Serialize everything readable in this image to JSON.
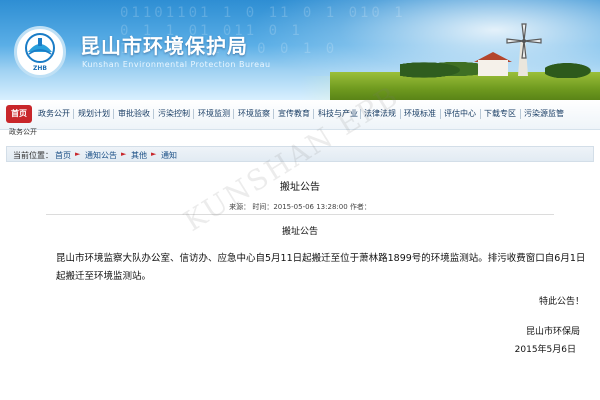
{
  "header": {
    "title": "昆山市环境保护局",
    "subtitle": "Kunshan Environmental Protection Bureau",
    "logo_label": "ZHB",
    "binary_pattern": "01101101 1 0 11 0 1 010 1\n0 1 1 01 011 0 1\n1 0 1 0 1 1 0 0 1 0"
  },
  "nav": {
    "items": [
      {
        "label": "首页",
        "active": true
      },
      {
        "label": "政务公开"
      },
      {
        "label": "规划计划"
      },
      {
        "label": "审批验收"
      },
      {
        "label": "污染控制"
      },
      {
        "label": "环境监测"
      },
      {
        "label": "环境监察"
      },
      {
        "label": "宣传教育"
      },
      {
        "label": "科技与产业"
      },
      {
        "label": "法律法规"
      },
      {
        "label": "环境标准"
      },
      {
        "label": "评估中心"
      },
      {
        "label": "下载专区"
      },
      {
        "label": "污染源监管"
      }
    ],
    "subnav_label": "政务公开"
  },
  "breadcrumb": {
    "prefix": "当前位置：",
    "items": [
      "首页",
      "通知公告",
      "其他",
      "通知"
    ]
  },
  "article": {
    "title": "搬址公告",
    "meta": "来源：  时间：2015-05-06 13:28:00  作者：",
    "subtitle": "搬址公告",
    "body": "昆山市环境监察大队办公室、信访办、应急中心自5月11日起搬迁至位于萧林路1899号的环境监测站。排污收费窗口自6月1日起搬迁至环境监测站。",
    "notice": "特此公告！",
    "signature": "昆山市环保局",
    "date": "2015年5月6日"
  },
  "watermark": "KUNSHAN EPB",
  "colors": {
    "nav_active": "#c8262a",
    "banner_top": "#2e8ed3",
    "link": "#1a4f86"
  }
}
